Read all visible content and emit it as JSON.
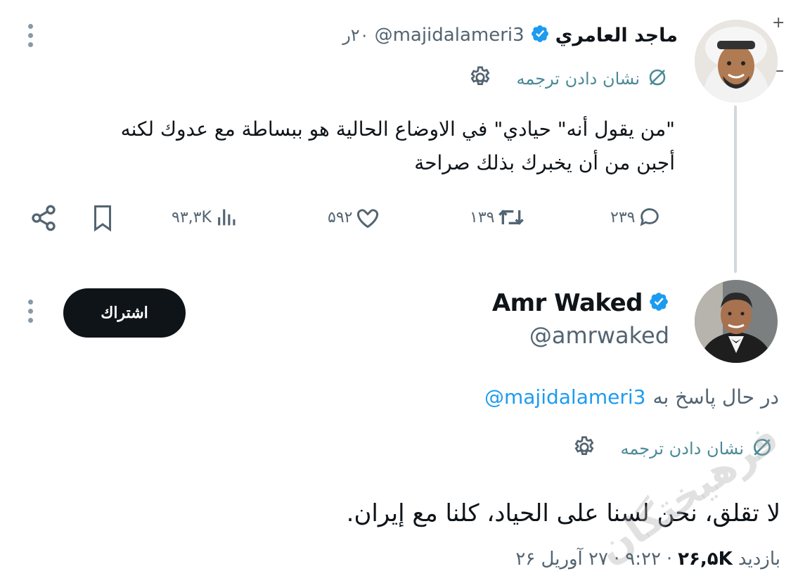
{
  "corner_plus": "+",
  "tweet1": {
    "display_name": "ماجد العامري",
    "handle": "@majidalameri3",
    "time": "۲۰ر",
    "translate_label": "نشان دادن ترجمه",
    "body_line1": "\"من يقول أنه\" حيادي\" في الاوضاع الحالية هو ببساطة مع عدوك لكنه",
    "body_line2": "أجبن من أن يخبرك بذلك صراحة",
    "replies": "۲۳۹",
    "retweets": "۱۳۹",
    "likes": "۵۹۲",
    "views": "۹۳,۳K"
  },
  "tweet2": {
    "display_name": "Amr Waked",
    "handle": "@amrwaked",
    "subscribe_label": "اشتراك",
    "replying_to_prefix": "در حال پاسخ به",
    "replying_to_handle": "@majidalameri3",
    "translate_label": "نشان دادن ترجمه",
    "body": "لا تقلق، نحن لسنا على الحياد، كلنا مع إيران.",
    "views_label": "بازدید",
    "views_count": "۲۶,۵K",
    "time": "۹:۲۲",
    "date": "۲۷ آوریل ۲۶",
    "separator": "·"
  },
  "watermark": "فرهیختگان",
  "colors": {
    "verified": "#1d9bf0",
    "translate": "#4a8a97",
    "muted": "#536471"
  }
}
